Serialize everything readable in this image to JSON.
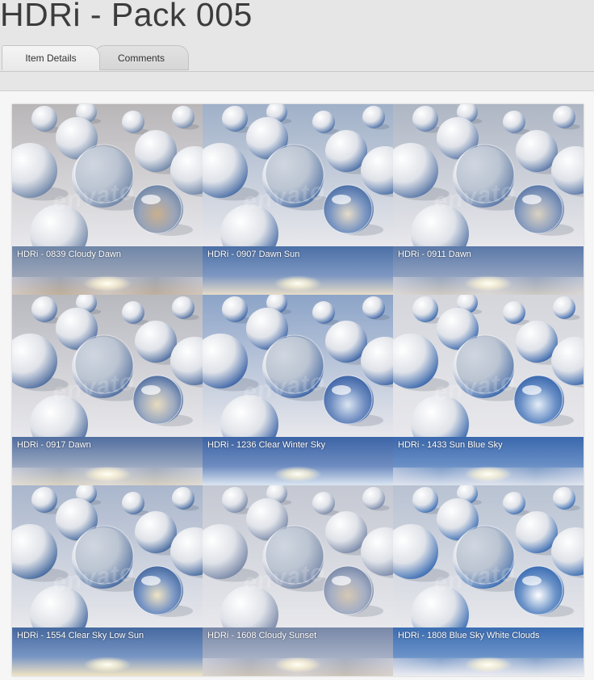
{
  "page": {
    "title": "HDRi - Pack 005"
  },
  "tabs": [
    {
      "label": "Item Details",
      "active": true
    },
    {
      "label": "Comments",
      "active": false
    }
  ],
  "preview": {
    "watermark": "envato",
    "tiles": [
      {
        "caption": "HDRi - 0839 Cloudy Dawn",
        "sky": [
          "#9aa4b8",
          "#6f86a8",
          "#c9b08f"
        ],
        "floor": "#b9b6b8",
        "clouds": true
      },
      {
        "caption": "HDRi - 0907 Dawn Sun",
        "sky": [
          "#7d97c2",
          "#4b6fa6",
          "#e6dcc8"
        ],
        "floor": "#9fb0c8",
        "clouds": false
      },
      {
        "caption": "HDRi - 0911 Dawn",
        "sky": [
          "#8ea0bf",
          "#5a78a8",
          "#dbd2c2"
        ],
        "floor": "#aeb6c4",
        "clouds": true
      },
      {
        "caption": "HDRi - 0917 Dawn",
        "sky": [
          "#9aa8c0",
          "#506ea0",
          "#e8dcc0"
        ],
        "floor": "#b8b9bf",
        "clouds": true
      },
      {
        "caption": "HDRi - 1236 Clear Winter Sky",
        "sky": [
          "#6e8cc0",
          "#3c64a6",
          "#dbe6f2"
        ],
        "floor": "#8ca4c8",
        "clouds": false
      },
      {
        "caption": "HDRi - 1433 Sun Blue Sky",
        "sky": [
          "#6a90c6",
          "#3a68ad",
          "#e6eef8"
        ],
        "floor": "#d4d6dc",
        "clouds": true
      },
      {
        "caption": "HDRi - 1554  Clear Sky Low Sun",
        "sky": [
          "#7895c4",
          "#45699f",
          "#f0e4c4"
        ],
        "floor": "#a9b6cc",
        "clouds": false
      },
      {
        "caption": "HDRi - 1608 Cloudy Sunset",
        "sky": [
          "#a4aec4",
          "#7888a8",
          "#d6c8b4"
        ],
        "floor": "#c4c8d2",
        "clouds": true
      },
      {
        "caption": "HDRi - 1808 Blue Sky White Clouds",
        "sky": [
          "#6c93c8",
          "#3b6db3",
          "#ffffff"
        ],
        "floor": "#b8c2d2",
        "clouds": true
      }
    ]
  }
}
